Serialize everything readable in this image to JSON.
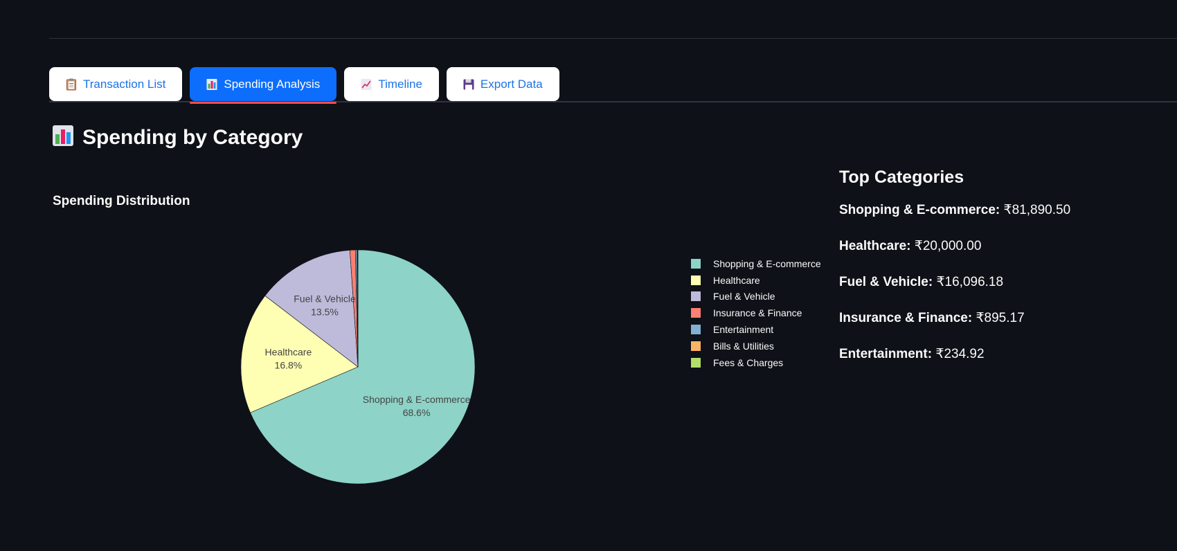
{
  "tabs": [
    {
      "label": "Transaction List",
      "icon": "clipboard-icon",
      "active": false
    },
    {
      "label": "Spending Analysis",
      "icon": "bar-chart-icon",
      "active": true
    },
    {
      "label": "Timeline",
      "icon": "line-chart-icon",
      "active": false
    },
    {
      "label": "Export Data",
      "icon": "floppy-disk-icon",
      "active": false
    }
  ],
  "page": {
    "heading": "Spending by Category",
    "subheading": "Spending Distribution"
  },
  "top_categories": {
    "title": "Top Categories",
    "items": [
      {
        "name": "Shopping & E-commerce:",
        "amount": "₹81,890.50"
      },
      {
        "name": "Healthcare:",
        "amount": "₹20,000.00"
      },
      {
        "name": "Fuel & Vehicle:",
        "amount": "₹16,096.18"
      },
      {
        "name": "Insurance & Finance:",
        "amount": "₹895.17"
      },
      {
        "name": "Entertainment:",
        "amount": "₹234.92"
      }
    ]
  },
  "chart_data": {
    "type": "pie",
    "title": "Spending Distribution",
    "legend_position": "right",
    "slices": [
      {
        "name": "Shopping & E-commerce",
        "percent": 68.6,
        "label": "68.6%",
        "color": "#8dd3c7"
      },
      {
        "name": "Healthcare",
        "percent": 16.8,
        "label": "16.8%",
        "color": "#ffffb3"
      },
      {
        "name": "Fuel & Vehicle",
        "percent": 13.5,
        "label": "13.5%",
        "color": "#bebada"
      },
      {
        "name": "Insurance & Finance",
        "percent": 0.75,
        "label": "",
        "color": "#fb8072"
      },
      {
        "name": "Entertainment",
        "percent": 0.2,
        "label": "",
        "color": "#80b1d3"
      },
      {
        "name": "Bills & Utilities",
        "percent": 0.1,
        "label": "",
        "color": "#fdb462"
      },
      {
        "name": "Fees & Charges",
        "percent": 0.05,
        "label": "",
        "color": "#b3de69"
      }
    ]
  }
}
